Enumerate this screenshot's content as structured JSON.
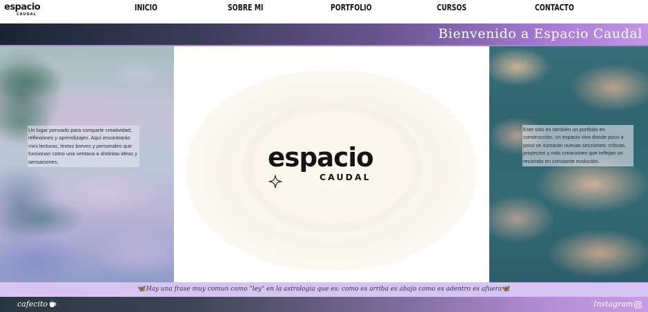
{
  "brand": {
    "word": "espacio",
    "sub": "CAUDAL"
  },
  "nav": {
    "items": [
      {
        "label": "INICIO"
      },
      {
        "label": "SOBRE MI"
      },
      {
        "label": "PORTFOLIO"
      },
      {
        "label": "CURSOS"
      },
      {
        "label": "CONTACTO"
      }
    ]
  },
  "banner": {
    "title": "Bienvenido a Espacio Caudal"
  },
  "hero": {
    "left_text": "Un lugar pensado para compartir creatividad, reflexiones y aprendizajes. Aquí encontrarás mini lecturas, textos breves y personales que funcionan como una ventana a distintas ideas y sensaciones.",
    "right_text": "Este sitio es también un portfolio en construcción, un espacio vivo donde poco a poco se sumarán nuevas secciones: críticas, proyectos y más creaciones que reflejan un recorrido en constante evolución."
  },
  "quote": {
    "text": "Hay una frase muy comun como \"ley\" en la astrologia que es: como es arriba es abajo como es adentro es afuera"
  },
  "footer": {
    "left_label": "cafecito",
    "right_label": "Instagram"
  },
  "colors": {
    "banner_start": "#1b2433",
    "banner_end": "#c295e6",
    "quote_bar": "#d6c4f2",
    "footer_start": "#2a3642",
    "footer_end": "#c79be6"
  },
  "icons": [
    "sparkle-icon",
    "butterfly-icon",
    "coffee-cup-icon",
    "instagram-icon"
  ]
}
